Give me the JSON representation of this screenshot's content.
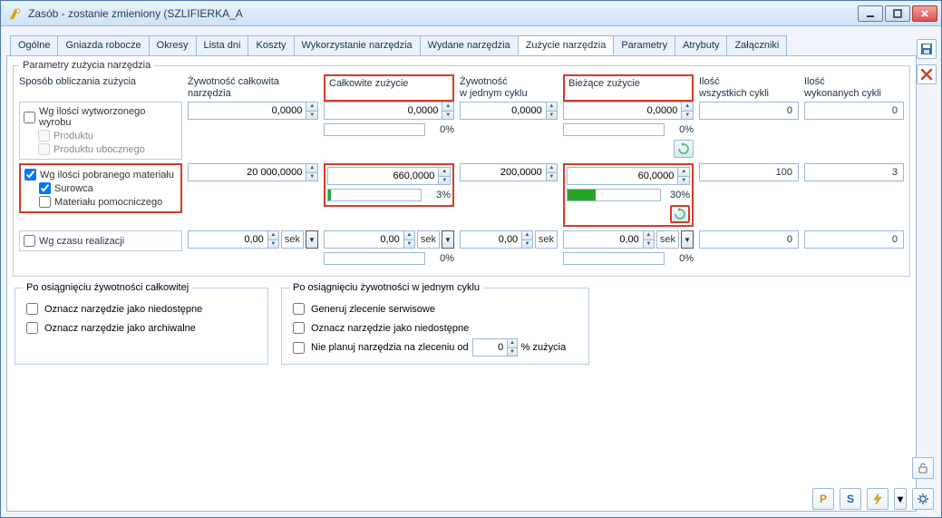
{
  "window": {
    "title": "Zasób - zostanie zmieniony  (SZLIFIERKA_A"
  },
  "tabs": [
    "Ogólne",
    "Gniazda robocze",
    "Okresy",
    "Lista dni",
    "Koszty",
    "Wykorzystanie narzędzia",
    "Wydane narzędzia",
    "Zużycie narzędzia",
    "Parametry",
    "Atrybuty",
    "Załączniki"
  ],
  "active_tab_index": 7,
  "group_legend": "Parametry zużycia narzędzia",
  "headers": {
    "method": "Sposób obliczania zużycia",
    "life_total": "Żywotność całkowita narzędzia",
    "wear_total": "Całkowite zużycie",
    "life_cycle": "Żywotność\nw jednym cyklu",
    "wear_current": "Bieżące zużycie",
    "cycles_all": "Ilość\nwszystkich cykli",
    "cycles_done": "Ilość\nwykonanych cykli"
  },
  "methods": {
    "by_product": {
      "main": "Wg ilości wytworzonego wyrobu",
      "sub1": "Produktu",
      "sub2": "Produktu ubocznego"
    },
    "by_material": {
      "main": "Wg ilości pobranego materiału",
      "sub1": "Surowca",
      "sub2": "Materiału pomocniczego"
    },
    "by_time": {
      "main": "Wg czasu realizacji"
    }
  },
  "rows": {
    "r1": {
      "life_total": "0,0000",
      "wear_total": "0,0000",
      "wear_total_pct": "0%",
      "wear_total_fill": 0,
      "life_cycle": "0,0000",
      "wear_current": "0,0000",
      "wear_current_pct": "0%",
      "wear_current_fill": 0,
      "cycles_all": "0",
      "cycles_done": "0"
    },
    "r2": {
      "life_total": "20 000,0000",
      "wear_total": "660,0000",
      "wear_total_pct": "3%",
      "wear_total_fill": 3,
      "life_cycle": "200,0000",
      "wear_current": "60,0000",
      "wear_current_pct": "30%",
      "wear_current_fill": 30,
      "cycles_all": "100",
      "cycles_done": "3"
    },
    "r3": {
      "life_total": "0,00",
      "wear_total": "0,00",
      "wear_total_pct": "0%",
      "life_cycle": "0,00",
      "wear_current": "0,00",
      "wear_current_pct": "0%",
      "cycles_all": "0",
      "cycles_done": "0",
      "unit": "sek"
    }
  },
  "bottom": {
    "left_legend": "Po osiągnięciu żywotności całkowitej",
    "left1": "Oznacz narzędzie jako niedostępne",
    "left2": "Oznacz narzędzie jako archiwalne",
    "right_legend": "Po osiągnięciu żywotności w jednym cyklu",
    "right1": "Generuj zlecenie serwisowe",
    "right2": "Oznacz narzędzie jako niedostępne",
    "right3a": "Nie planuj narzędzia na zleceniu od",
    "right3b": "% zużycia",
    "right3_val": "0"
  },
  "side": {
    "save": "save",
    "delete": "delete"
  },
  "footer": {
    "p": "P",
    "s": "S"
  }
}
